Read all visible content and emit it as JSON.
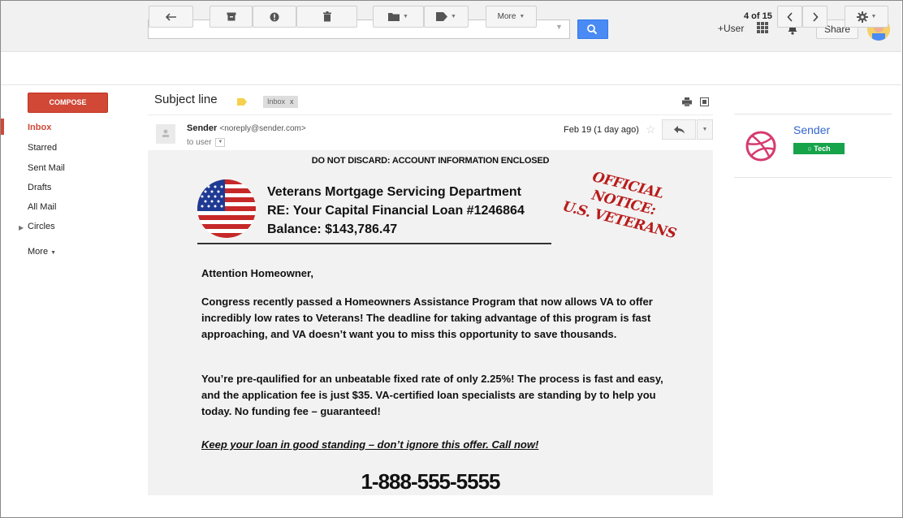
{
  "topbar": {
    "user_link": "+User",
    "share_label": "Share"
  },
  "toolbar": {
    "more_label": "More",
    "page_current": "4",
    "page_sep": " of ",
    "page_total": "15"
  },
  "nav": {
    "compose_label": "COMPOSE",
    "items": [
      "Inbox",
      "Starred",
      "Sent Mail",
      "Drafts",
      "All Mail",
      "Circles",
      "More"
    ]
  },
  "email": {
    "subject": "Subject line",
    "inbox_chip": "Inbox",
    "inbox_chip_close": "x",
    "sender_name": "Sender",
    "sender_email": "<noreply@sender.com>",
    "to_line": "to user",
    "date": "Feb 19 (1 day ago)"
  },
  "letter": {
    "discard_notice": "DO NOT DISCARD: ACCOUNT INFORMATION ENCLOSED",
    "dept": "Veterans Mortgage Servicing Department",
    "loan_ref": "RE: Your Capital Financial Loan #1246864",
    "balance": "Balance: $143,786.47",
    "stamp_line1": "Official Notice:",
    "stamp_line2": "U.S. Veterans",
    "greeting": "Attention Homeowner,",
    "paragraph1": "Congress recently passed a Homeowners Assistance Program that now allows VA to offer incredibly low rates to Veterans! The deadline for taking advantage of this program is fast approaching, and VA doesn’t want you to miss this opportunity to save thousands.",
    "paragraph2": "You’re pre-qaulified for an unbeatable fixed rate of only 2.25%! The process is fast and easy, and the application fee is just $35. VA-certified loan specialists are standing by to help you today. No funding fee – guaranteed!",
    "cta": "Keep your loan in good standing – don’t ignore this offer. Call now!",
    "phone": "1-888-555-5555"
  },
  "side": {
    "sender_name": "Sender",
    "tag_label": "Tech",
    "tag_color": "#16a34a",
    "icon": "dribbble-icon"
  },
  "colors": {
    "compose": "#d14836",
    "search_button": "#4a8af4",
    "stamp": "#b91c1c",
    "link": "#3366cc"
  }
}
